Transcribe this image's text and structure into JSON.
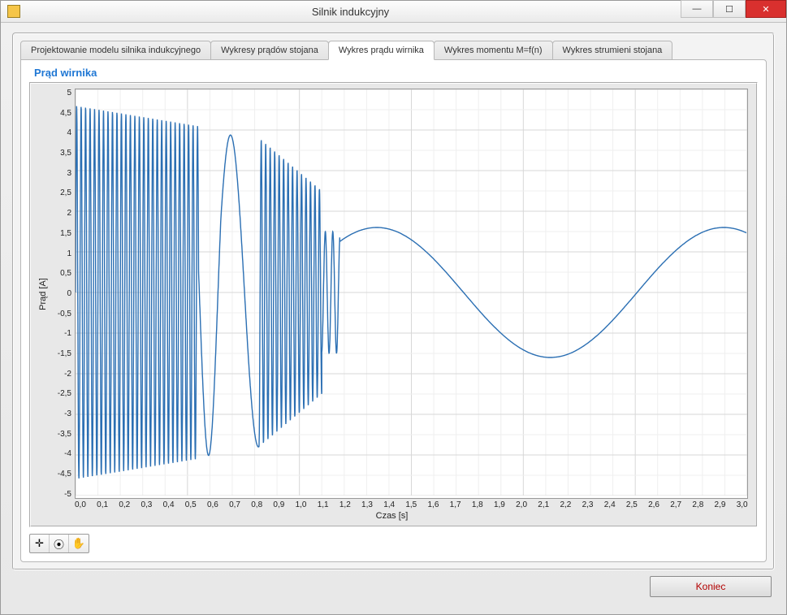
{
  "window": {
    "title": "Silnik indukcyjny"
  },
  "tabs": [
    {
      "label": "Projektowanie modelu silnika indukcyjnego"
    },
    {
      "label": "Wykresy prądów stojana"
    },
    {
      "label": "Wykres prądu wirnika"
    },
    {
      "label": "Wykres momentu M=f(n)"
    },
    {
      "label": "Wykres strumieni stojana"
    }
  ],
  "active_tab_index": 2,
  "chart_title": "Prąd wirnika",
  "buttons": {
    "end": "Koniec"
  },
  "toolbar_icons": {
    "crosshair": "✛",
    "zoom": "⦿",
    "hand": "✋"
  },
  "chart_data": {
    "type": "line",
    "title": "Prąd wirnika",
    "xlabel": "Czas  [s]",
    "ylabel": "Prąd [A]",
    "xlim": [
      0.0,
      3.0
    ],
    "ylim": [
      -5.0,
      5.0
    ],
    "xticks": [
      "0,0",
      "0,1",
      "0,2",
      "0,3",
      "0,4",
      "0,5",
      "0,6",
      "0,7",
      "0,8",
      "0,9",
      "1,0",
      "1,1",
      "1,2",
      "1,3",
      "1,4",
      "1,5",
      "1,6",
      "1,7",
      "1,8",
      "1,9",
      "2,0",
      "2,1",
      "2,2",
      "2,3",
      "2,4",
      "2,5",
      "2,6",
      "2,7",
      "2,8",
      "2,9",
      "3,0"
    ],
    "yticks": [
      "5",
      "4,5",
      "4",
      "3,5",
      "3",
      "2,5",
      "2",
      "1,5",
      "1",
      "0,5",
      "0",
      "-0,5",
      "-1",
      "-1,5",
      "-2",
      "-2,5",
      "-3",
      "-3,5",
      "-4",
      "-4,5",
      "-5"
    ],
    "envelopes": [
      {
        "t0": 0.0,
        "t1": 0.55,
        "amp0": 4.6,
        "amp1": 4.1,
        "freq_hz": 50
      },
      {
        "t0": 0.55,
        "t1": 0.65,
        "amp0": 4.1,
        "amp1": 3.9,
        "freq_hz": 6
      },
      {
        "t0": 0.65,
        "t1": 0.82,
        "amp0": 3.9,
        "amp1": 3.8,
        "freq_hz": 4
      },
      {
        "t0": 0.82,
        "t1": 1.1,
        "amp0": 3.8,
        "amp1": 2.5,
        "freq_hz": 50
      },
      {
        "t0": 1.1,
        "t1": 1.18,
        "amp0": 1.5,
        "amp1": 1.5,
        "freq_hz": 30
      }
    ],
    "steady_state": {
      "t0": 1.18,
      "t1": 3.0,
      "amp": 1.6,
      "period_s": 1.55,
      "offset": 0.0,
      "phase_at_t0": 0.9
    },
    "notes": "Transient with decaying-amplitude high-frequency oscillation (~50 Hz, amplitude ~4.5→0) until ~1.2 s, then steady sinusoid amplitude ≈1.6 A, period ≈1.55 s."
  }
}
